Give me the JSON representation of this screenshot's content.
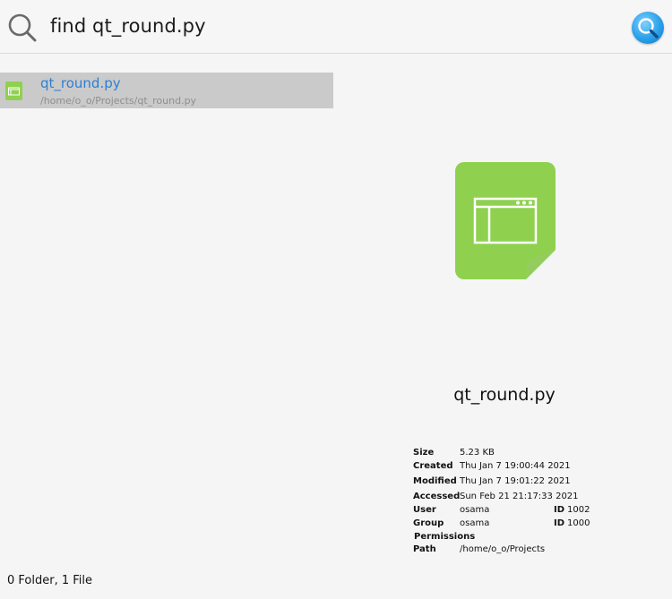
{
  "search": {
    "query": "find qt_round.py",
    "icon": "magnifier-icon",
    "button_icon": "search-button-icon"
  },
  "results": [
    {
      "name": "qt_round.py",
      "path": "/home/o_o/Projects/qt_round.py",
      "icon": "python-file-icon",
      "selected": true
    }
  ],
  "preview": {
    "icon": "python-file-icon",
    "icon_color": "#8fd14f",
    "name": "qt_round.py",
    "details": {
      "size_label": "Size",
      "size": "5.23 KB",
      "created_label": "Created",
      "created": "Thu Jan 7 19:00:44 2021",
      "modified_label": "Modified",
      "modified": "Thu Jan 7 19:01:22 2021",
      "accessed_label": "Accessed",
      "accessed": "Sun Feb 21 21:17:33 2021",
      "user_label": "User",
      "user": "osama",
      "user_id_label": "ID",
      "user_id": "1002",
      "group_label": "Group",
      "group": "osama",
      "group_id_label": "ID",
      "group_id": "1000",
      "permissions_label": "Permissions",
      "path_label": "Path",
      "path": "/home/o_o/Projects"
    }
  },
  "status": {
    "summary": "0 Folder, 1 File"
  },
  "colors": {
    "accent_blue": "#2c7fd6",
    "selection_bg": "#cacaca",
    "file_green": "#8fd14f"
  }
}
